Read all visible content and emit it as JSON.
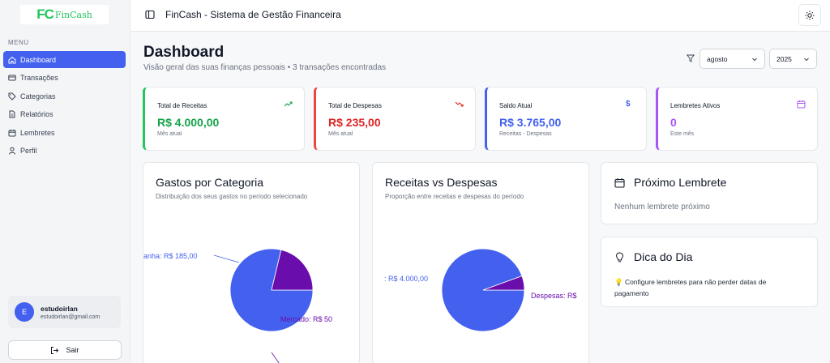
{
  "brand": {
    "mark": "FC",
    "name": "FinCash"
  },
  "sidebar": {
    "menu_label": "MENU",
    "items": [
      {
        "label": "Dashboard",
        "icon": "home-icon",
        "active": true
      },
      {
        "label": "Transações",
        "icon": "credit-card-icon"
      },
      {
        "label": "Categorias",
        "icon": "tag-icon"
      },
      {
        "label": "Relatórios",
        "icon": "file-icon"
      },
      {
        "label": "Lembretes",
        "icon": "calendar-icon"
      },
      {
        "label": "Perfil",
        "icon": "user-icon"
      }
    ],
    "user": {
      "initial": "E",
      "name": "estudoirlan",
      "email": "estudoirlan@gmail.com"
    },
    "logout_label": "Sair"
  },
  "header": {
    "title": "FinCash - Sistema de Gestão Financeira"
  },
  "main": {
    "title": "Dashboard",
    "subtitle": "Visão geral das suas finanças pessoais • 3 transações encontradas",
    "month_select": "agosto",
    "year_select": "2025"
  },
  "stats": [
    {
      "title": "Total de Receitas",
      "value": "R$ 4.000,00",
      "sub": "Mês atual",
      "color": "#16a34a",
      "icon": "trending-up-icon"
    },
    {
      "title": "Total de Despesas",
      "value": "R$ 235,00",
      "sub": "Mês atual",
      "color": "#dc2626",
      "icon": "trending-down-icon"
    },
    {
      "title": "Saldo Atual",
      "value": "R$ 3.765,00",
      "sub": "Receitas - Despesas",
      "color": "#4361ee",
      "icon": "dollar-icon"
    },
    {
      "title": "Lembretes Ativos",
      "value": "0",
      "sub": "Este mês",
      "color": "#a855f7",
      "icon": "calendar-icon"
    }
  ],
  "charts": {
    "category": {
      "title": "Gastos por Categoria",
      "subtitle": "Distribuição dos seus gastos no período selecionado",
      "label_a": "anha: R$ 185,00",
      "label_b": "Mercado: R$ 50"
    },
    "income_expense": {
      "title": "Receitas vs Despesas",
      "subtitle": "Proporção entre receitas e despesas do período",
      "label_a": ": R$ 4.000,00",
      "label_b": "Despesas: R$"
    }
  },
  "chart_data": [
    {
      "type": "pie",
      "title": "Gastos por Categoria",
      "slices": [
        {
          "value": 185,
          "color": "#4361ee"
        },
        {
          "value": 50,
          "color": "#6a0dad"
        }
      ]
    },
    {
      "type": "pie",
      "title": "Receitas vs Despesas",
      "slices": [
        {
          "value": 4000,
          "color": "#4361ee"
        },
        {
          "value": 235,
          "color": "#6a0dad"
        }
      ]
    }
  ],
  "reminder": {
    "title": "Próximo Lembrete",
    "text": "Nenhum lembrete próximo"
  },
  "tip": {
    "title": "Dica do Dia",
    "text": "💡 Configure lembretes para não perder datas de pagamento"
  }
}
